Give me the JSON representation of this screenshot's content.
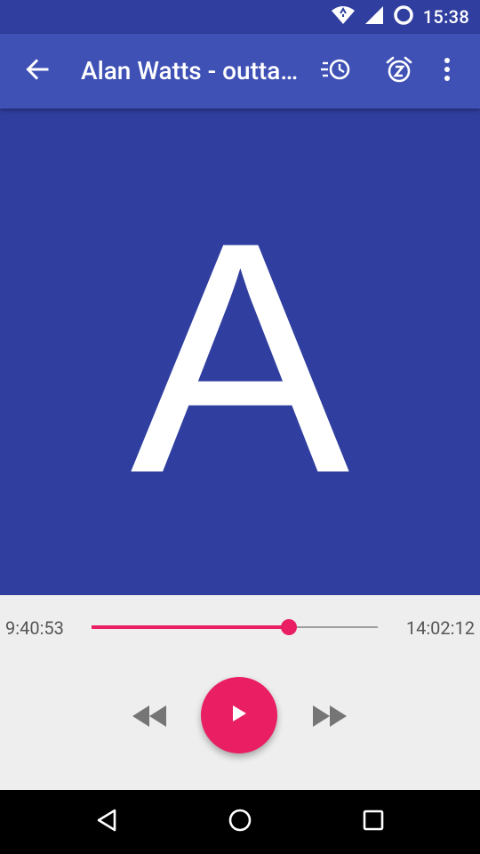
{
  "status_bar": {
    "time": "15:38",
    "icons": [
      "wifi-icon",
      "cell-signal-icon",
      "sync-circle-icon"
    ]
  },
  "toolbar": {
    "title": "Alan Watts - outtakes",
    "back_icon": "arrow-back-icon",
    "actions": [
      "playback-speed-icon",
      "sleep-timer-icon",
      "more-vert-icon"
    ]
  },
  "artwork": {
    "letter": "A",
    "background_color": "#303f9f"
  },
  "player": {
    "elapsed": "9:40:53",
    "total": "14:02:12",
    "progress": 0.69,
    "accent_color": "#e91e63",
    "rewind_icon": "rewind-icon",
    "play_icon": "play-icon",
    "forward_icon": "fast-forward-icon"
  },
  "nav_bar": {
    "icons": [
      "back-triangle-icon",
      "home-circle-icon",
      "recents-square-icon"
    ]
  },
  "colors": {
    "primary": "#3f51b5",
    "primary_dark": "#303f9f",
    "accent": "#e91e63"
  }
}
